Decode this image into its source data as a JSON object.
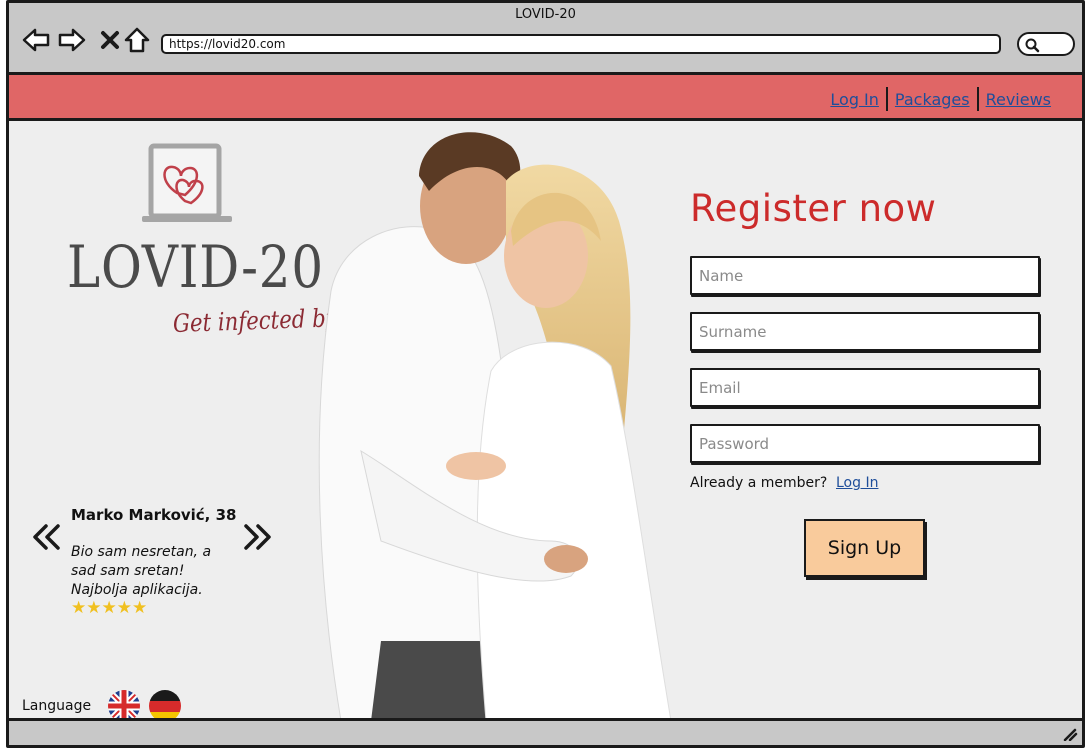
{
  "window": {
    "title": "LOVID-20",
    "url": "https://lovid20.com"
  },
  "navbar": {
    "links": [
      "Log In",
      "Packages",
      "Reviews"
    ],
    "bg_color": "#e06666"
  },
  "logo": {
    "title": "LOVID-20",
    "tagline": "Get infected by love!"
  },
  "testimonial": {
    "name": "Marko Marković, 38",
    "quote": "Bio sam nesretan, a sad sam sretan! Najbolja aplikacija.",
    "rating": 5,
    "stars": "★★★★★"
  },
  "language": {
    "label": "Language",
    "options": [
      "uk-flag-icon",
      "germany-flag-icon"
    ]
  },
  "register": {
    "title": "Register now",
    "name_placeholder": "Name",
    "surname_placeholder": "Surname",
    "email_placeholder": "Email",
    "password_placeholder": "Password",
    "member_text": "Already a member?",
    "login_link": "Log In",
    "signup_label": "Sign Up",
    "title_color": "#cc2b2b",
    "button_color": "#f9cb9c"
  }
}
